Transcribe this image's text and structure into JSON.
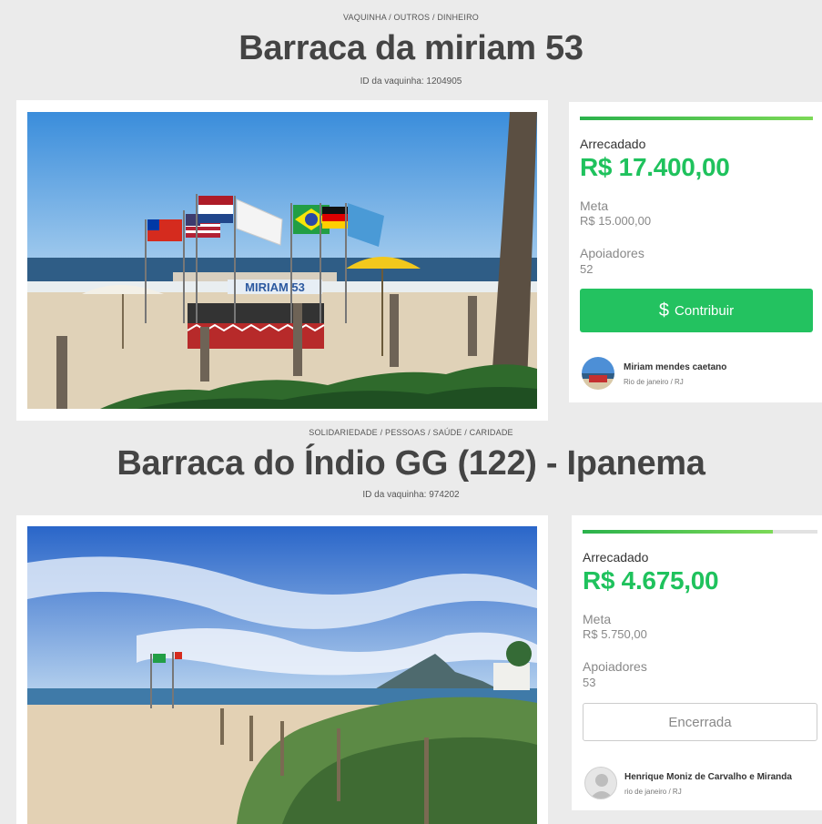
{
  "campaigns": [
    {
      "category": "VAQUINHA / OUTROS / DINHEIRO",
      "title": "Barraca da miriam 53",
      "id_text": "ID da vaquinha: 1204905",
      "raised_label": "Arrecadado",
      "raised_amount": "R$ 17.400,00",
      "goal_label": "Meta",
      "goal_amount": "R$ 15.000,00",
      "supporters_label": "Apoiadores",
      "supporters_count": "52",
      "progress_fraction": 1.0,
      "action_label": "Contribuir",
      "action_icon": "dollar-icon",
      "owner_name": "Miriam mendes caetano",
      "owner_location": "Rio de janeiro / RJ",
      "photo_banner_text": "MIRIAM 53"
    },
    {
      "category": "SOLIDARIEDADE / PESSOAS / SAÚDE / CARIDADE",
      "title": "Barraca do Índio GG (122) - Ipanema",
      "id_text": "ID da vaquinha: 974202",
      "raised_label": "Arrecadado",
      "raised_amount": "R$ 4.675,00",
      "goal_label": "Meta",
      "goal_amount": "R$ 5.750,00",
      "supporters_label": "Apoiadores",
      "supporters_count": "53",
      "progress_fraction": 0.81,
      "action_label": "Encerrada",
      "owner_name": "Henrique Moniz de Carvalho e Miranda",
      "owner_location": "rio de janeiro / RJ"
    }
  ],
  "colors": {
    "accent_green": "#23c260",
    "amount_green": "#1fc25d",
    "page_bg": "#ebebeb"
  }
}
